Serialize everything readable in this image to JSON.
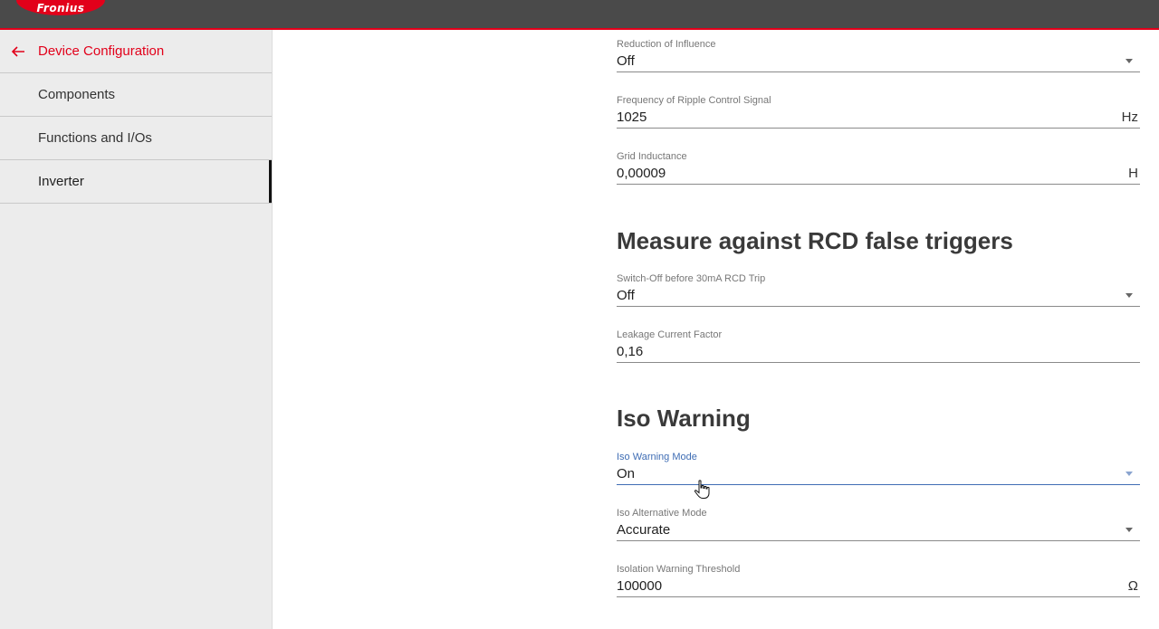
{
  "app": {
    "brand": "Fronius",
    "brand_color": "#e2001a"
  },
  "sidebar": {
    "back_label": "Device Configuration",
    "items": [
      {
        "label": "Components",
        "active": false
      },
      {
        "label": "Functions and I/Os",
        "active": false
      },
      {
        "label": "Inverter",
        "active": true
      }
    ]
  },
  "fields": {
    "reduction_of_influence": {
      "label": "Reduction of Influence",
      "value": "Off",
      "type": "select"
    },
    "ripple_frequency": {
      "label": "Frequency of Ripple Control Signal",
      "value": "1025",
      "unit": "Hz"
    },
    "grid_inductance": {
      "label": "Grid Inductance",
      "value": "0,00009",
      "unit": "H"
    },
    "switch_off_rcd": {
      "label": "Switch-Off before 30mA RCD Trip",
      "value": "Off",
      "type": "select"
    },
    "leakage_factor": {
      "label": "Leakage Current Factor",
      "value": "0,16"
    },
    "iso_warning_mode": {
      "label": "Iso Warning Mode",
      "value": "On",
      "type": "select",
      "focused": true
    },
    "iso_alternative_mode": {
      "label": "Iso Alternative Mode",
      "value": "Accurate",
      "type": "select"
    },
    "isolation_threshold": {
      "label": "Isolation Warning Threshold",
      "value": "100000",
      "unit": "Ω"
    }
  },
  "sections": {
    "rcd": "Measure against RCD false triggers",
    "iso": "Iso Warning"
  },
  "colors": {
    "topbar": "#4a4a4a",
    "accent_red": "#e2001a",
    "focus_blue": "#3f6db4",
    "sidebar_bg": "#ececec"
  }
}
